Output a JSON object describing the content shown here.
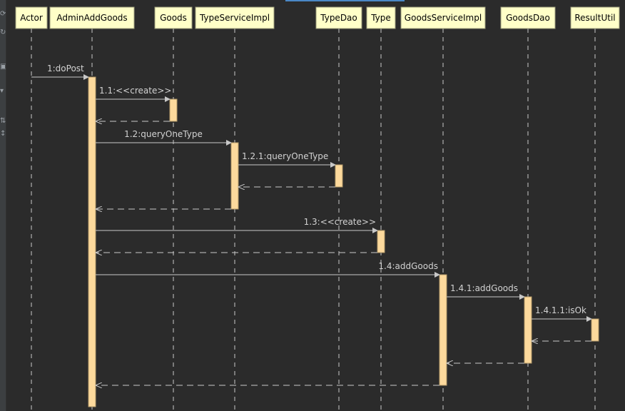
{
  "diagram": {
    "type": "sequence",
    "colors": {
      "background": "#2b2b2b",
      "lifeline_header": "#ffffc8",
      "activation": "#fcd99c",
      "line": "#c8c8c8",
      "text": "#d2d2d2"
    },
    "lifelines": [
      {
        "id": "actor",
        "label": "Actor"
      },
      {
        "id": "adminAddGoods",
        "label": "AdminAddGoods"
      },
      {
        "id": "goods",
        "label": "Goods"
      },
      {
        "id": "typeServiceImpl",
        "label": "TypeServiceImpl"
      },
      {
        "id": "typeDao",
        "label": "TypeDao"
      },
      {
        "id": "type",
        "label": "Type"
      },
      {
        "id": "goodsServiceImpl",
        "label": "GoodsServiceImpl"
      },
      {
        "id": "goodsDao",
        "label": "GoodsDao"
      },
      {
        "id": "resultUtil",
        "label": "ResultUtil"
      }
    ],
    "messages": [
      {
        "label": "1:doPost",
        "from": "actor",
        "to": "adminAddGoods",
        "kind": "call"
      },
      {
        "label": "1.1:<<create>>",
        "from": "adminAddGoods",
        "to": "goods",
        "kind": "call"
      },
      {
        "label": "",
        "from": "goods",
        "to": "adminAddGoods",
        "kind": "return"
      },
      {
        "label": "1.2:queryOneType",
        "from": "adminAddGoods",
        "to": "typeServiceImpl",
        "kind": "call"
      },
      {
        "label": "1.2.1:queryOneType",
        "from": "typeServiceImpl",
        "to": "typeDao",
        "kind": "call"
      },
      {
        "label": "",
        "from": "typeDao",
        "to": "typeServiceImpl",
        "kind": "return"
      },
      {
        "label": "",
        "from": "typeServiceImpl",
        "to": "adminAddGoods",
        "kind": "return"
      },
      {
        "label": "1.3:<<create>>",
        "from": "adminAddGoods",
        "to": "type",
        "kind": "call"
      },
      {
        "label": "",
        "from": "type",
        "to": "adminAddGoods",
        "kind": "return"
      },
      {
        "label": "1.4:addGoods",
        "from": "adminAddGoods",
        "to": "goodsServiceImpl",
        "kind": "call"
      },
      {
        "label": "1.4.1:addGoods",
        "from": "goodsServiceImpl",
        "to": "goodsDao",
        "kind": "call"
      },
      {
        "label": "1.4.1.1:isOk",
        "from": "goodsDao",
        "to": "resultUtil",
        "kind": "call"
      },
      {
        "label": "",
        "from": "resultUtil",
        "to": "goodsDao",
        "kind": "return"
      },
      {
        "label": "",
        "from": "goodsDao",
        "to": "goodsServiceImpl",
        "kind": "return"
      },
      {
        "label": "",
        "from": "goodsServiceImpl",
        "to": "adminAddGoods",
        "kind": "return"
      }
    ]
  }
}
